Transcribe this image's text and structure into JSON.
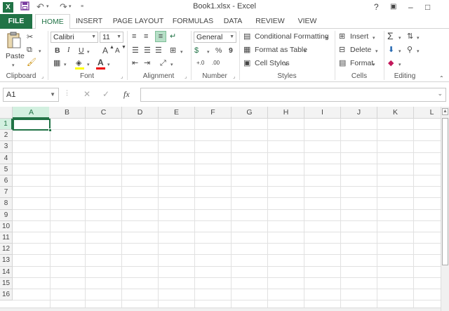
{
  "window": {
    "title": "Book1.xlsx - Excel",
    "app_icon_letter": "X",
    "quick_access": {
      "save_icon": "save-icon",
      "undo_icon": "undo-icon",
      "redo_icon": "redo-icon",
      "customize_icon": "customize-icon"
    },
    "controls": {
      "help": "?",
      "ribbon_display": "▣",
      "minimize": "–",
      "restore": "□"
    }
  },
  "tabs": [
    {
      "label": "FILE"
    },
    {
      "label": "HOME"
    },
    {
      "label": "INSERT"
    },
    {
      "label": "PAGE LAYOUT"
    },
    {
      "label": "FORMULAS"
    },
    {
      "label": "DATA"
    },
    {
      "label": "REVIEW"
    },
    {
      "label": "VIEW"
    }
  ],
  "active_tab": "HOME",
  "ribbon": {
    "clipboard": {
      "label": "Clipboard",
      "paste": "Paste"
    },
    "font": {
      "label": "Font",
      "family": "Calibri",
      "size": "11",
      "bold": "B",
      "italic": "I",
      "underline": "U",
      "grow": "A",
      "shrink": "A"
    },
    "alignment": {
      "label": "Alignment"
    },
    "number": {
      "label": "Number",
      "format": "General",
      "percent": "%",
      "comma": "9"
    },
    "styles": {
      "label": "Styles",
      "conditional": "Conditional Formatting",
      "format_table": "Format as Table",
      "cell_styles": "Cell Styles"
    },
    "cells": {
      "label": "Cells",
      "insert": "Insert",
      "delete": "Delete",
      "format": "Format"
    },
    "editing": {
      "label": "Editing",
      "sum": "Σ"
    }
  },
  "formula_bar": {
    "name_box": "A1",
    "fx": "fx",
    "value": ""
  },
  "grid": {
    "columns": [
      "A",
      "B",
      "C",
      "D",
      "E",
      "F",
      "G",
      "H",
      "I",
      "J",
      "K",
      "L"
    ],
    "rows": [
      "1",
      "2",
      "3",
      "4",
      "5",
      "6",
      "7",
      "8",
      "9",
      "10",
      "11",
      "12",
      "13",
      "14",
      "15",
      "16"
    ],
    "selected_cell": "A1"
  },
  "colors": {
    "accent": "#217346",
    "header_bg": "#f3f3f3",
    "selected_header_bg": "#d3f0e0"
  }
}
